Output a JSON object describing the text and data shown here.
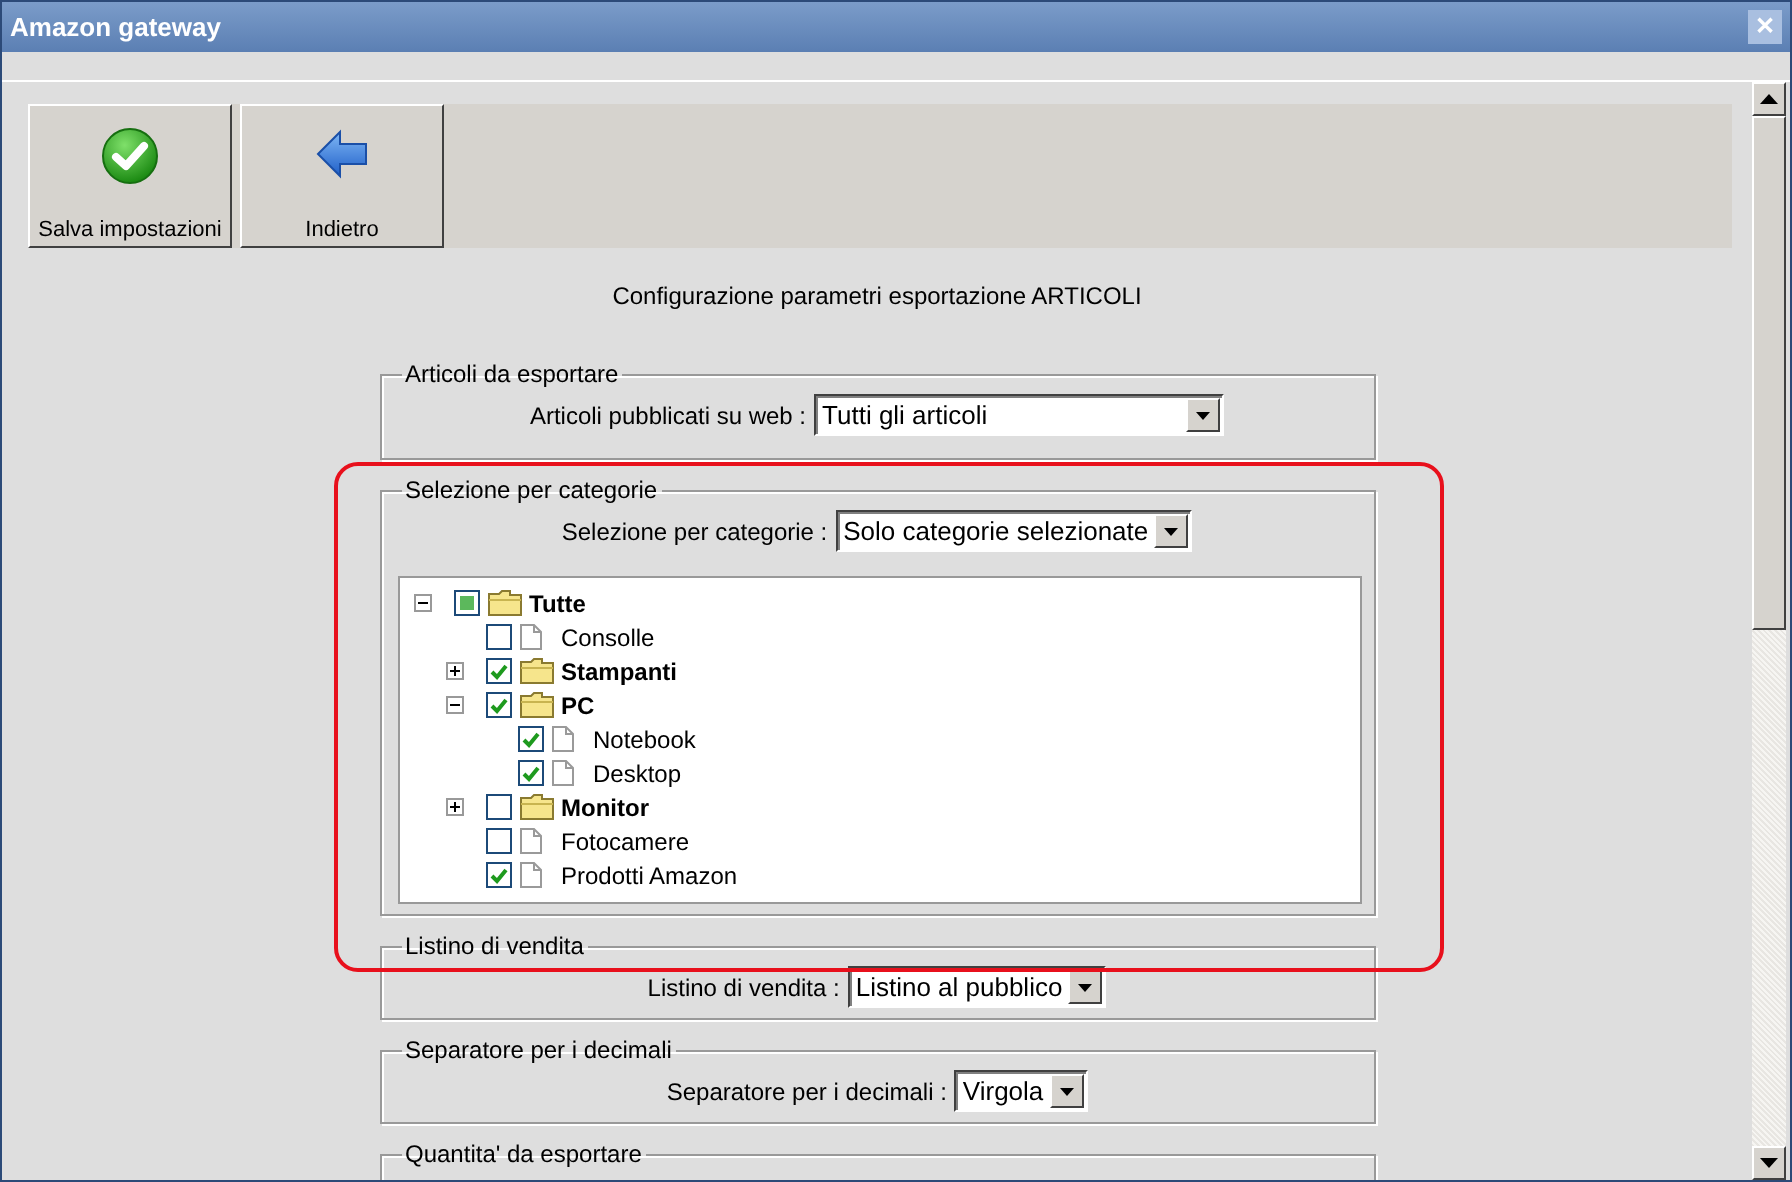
{
  "window": {
    "title": "Amazon gateway",
    "close": "✕"
  },
  "toolbar": [
    {
      "kind": "save",
      "label": "Salva impostazioni"
    },
    {
      "kind": "back",
      "label": "Indietro"
    }
  ],
  "heading": "Configurazione parametri esportazione ARTICOLI",
  "highlight_frame": true,
  "groups": [
    {
      "legend": "Articoli da esportare",
      "label": "Articoli pubblicati su web :",
      "value": "Tutti gli articoli"
    },
    {
      "legend": "Selezione per categorie",
      "label": "Selezione per categorie :",
      "value": "Solo categorie selezionate",
      "tree": [
        {
          "kind": "folder",
          "label": "Tutte",
          "checked": false,
          "partial": true,
          "expanded": true,
          "children": [
            {
              "kind": "file",
              "label": "Consolle",
              "checked": false,
              "partial": false
            },
            {
              "kind": "folder",
              "label": "Stampanti",
              "checked": true,
              "partial": false,
              "expanded": false
            },
            {
              "kind": "folder",
              "label": "PC",
              "checked": true,
              "partial": false,
              "expanded": true,
              "children": [
                {
                  "kind": "file",
                  "label": "Notebook",
                  "checked": true,
                  "partial": false
                },
                {
                  "kind": "file",
                  "label": "Desktop",
                  "checked": true,
                  "partial": false
                }
              ]
            },
            {
              "kind": "folder",
              "label": "Monitor",
              "checked": false,
              "partial": false,
              "expanded": false
            },
            {
              "kind": "file",
              "label": "Fotocamere",
              "checked": false,
              "partial": false
            },
            {
              "kind": "file",
              "label": "Prodotti Amazon",
              "checked": true,
              "partial": false
            }
          ]
        }
      ]
    },
    {
      "legend": "Listino di vendita",
      "label": "Listino di vendita :",
      "value": "Listino al pubblico"
    },
    {
      "legend": "Separatore per i decimali",
      "label": "Separatore per i decimali :",
      "value": "Virgola"
    },
    {
      "legend": "Quantita' da esportare"
    }
  ]
}
